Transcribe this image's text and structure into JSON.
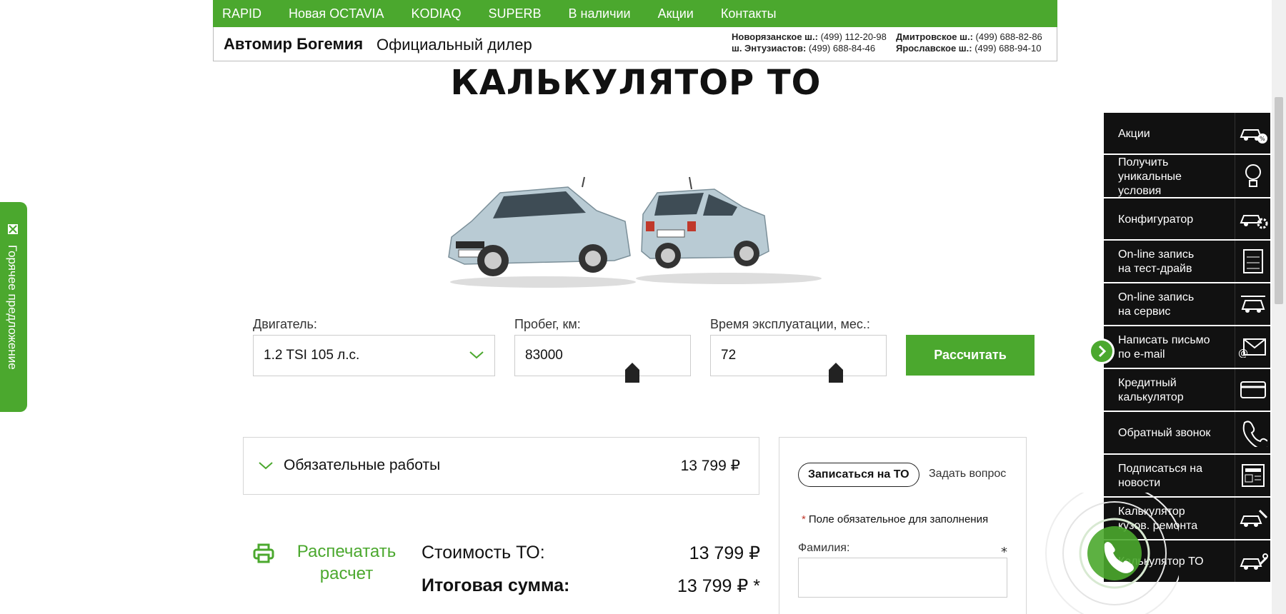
{
  "nav": {
    "items": [
      "RAPID",
      "Новая OCTAVIA",
      "KODIAQ",
      "SUPERB",
      "В наличии",
      "Акции",
      "Контакты"
    ]
  },
  "dealer": {
    "name": "Автомир Богемия",
    "subtitle": "Официальный дилер",
    "phones": {
      "novoryazanskoe_label": "Новорязанское ш.:",
      "novoryazanskoe_num": "(499) 112-20-98",
      "entuziastov_label": "ш. Энтузиастов:",
      "entuziastov_num": "(499) 688-84-46",
      "dmitrovskoe_label": "Дмитровское ш.:",
      "dmitrovskoe_num": "(499) 688-82-86",
      "yaroslavskoe_label": "Ярославское ш.:",
      "yaroslavskoe_num": "(499) 688-94-10"
    }
  },
  "page": {
    "title": "КАЛЬКУЛЯТОР ТО"
  },
  "form": {
    "engine_label": "Двигатель:",
    "engine_value": "1.2 TSI 105 л.с.",
    "mileage_label": "Пробег, км:",
    "mileage_value": "83000",
    "time_label": "Время эксплуатации, мес.:",
    "time_value": "72",
    "calc_button": "Рассчитать"
  },
  "works": {
    "label": "Обязательные работы",
    "price": "13 799 ₽"
  },
  "totals": {
    "print_label": "Распечатать расчет",
    "cost_label": "Стоимость ТО:",
    "cost_value": "13 799 ₽",
    "final_label": "Итоговая сумма:",
    "final_value": "13 799 ₽ *"
  },
  "booking": {
    "tab_active": "Записаться на ТО",
    "tab_inactive": "Задать вопрос",
    "required_star": "*",
    "required_note": "Поле обязательное для заполнения",
    "surname_label": "Фамилия:",
    "surname_star": "*",
    "surname_value": ""
  },
  "hot_offer": {
    "label": "Горячее предложение"
  },
  "sidebar": {
    "items": [
      {
        "label": "Акции",
        "icon": "car-discount-icon"
      },
      {
        "label": "Получить\nуникальные\nусловия",
        "icon": "lightbulb-icon"
      },
      {
        "label": "Конфигуратор",
        "icon": "car-gear-icon"
      },
      {
        "label": "On-line запись\nна тест-драйв",
        "icon": "test-drive-icon"
      },
      {
        "label": "On-line запись\nна сервис",
        "icon": "car-service-icon"
      },
      {
        "label": "Написать письмо\nпо e-mail",
        "icon": "email-icon"
      },
      {
        "label": "Кредитный\nкалькулятор",
        "icon": "credit-card-icon"
      },
      {
        "label": "Обратный звонок",
        "icon": "phone-icon"
      },
      {
        "label": "Подписаться на\nновости",
        "icon": "newspaper-icon"
      },
      {
        "label": "Калькулятор\nкузов. ремонта",
        "icon": "car-repair-icon"
      },
      {
        "label": "Калькулятор ТО",
        "icon": "car-wrench-icon"
      }
    ]
  },
  "colors": {
    "brand_green": "#4ba82e",
    "sidebar_bg": "#111111"
  }
}
